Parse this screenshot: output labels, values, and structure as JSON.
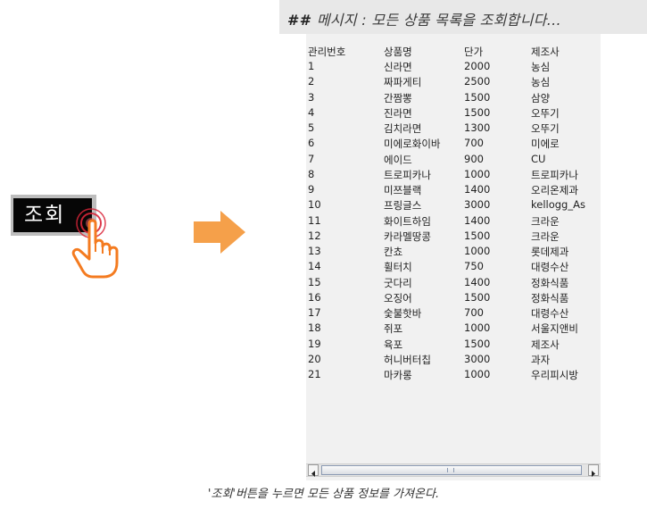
{
  "header": {
    "prefix": "##",
    "message": "메시지 : 모든 상품 목록을 조회합니다..."
  },
  "left_button": {
    "label": "조회"
  },
  "table": {
    "columns": [
      "관리번호",
      "상품명",
      "단가",
      "제조사"
    ],
    "rows": [
      [
        "1",
        "신라면",
        "2000",
        "농심"
      ],
      [
        "2",
        "짜파게티",
        "2500",
        "농심"
      ],
      [
        "3",
        "간짬뽕",
        "1500",
        "삼양"
      ],
      [
        "4",
        "진라면",
        "1500",
        "오뚜기"
      ],
      [
        "5",
        "김치라면",
        "1300",
        "오뚜기"
      ],
      [
        "6",
        "미에로화이바",
        "700",
        "미에로"
      ],
      [
        "7",
        "에이드",
        "900",
        "CU"
      ],
      [
        "8",
        "트로피카나",
        "1000",
        "트로피카나"
      ],
      [
        "9",
        "미쯔블랙",
        "1400",
        "오리온제과"
      ],
      [
        "10",
        "프링글스",
        "3000",
        "kellogg_As"
      ],
      [
        "11",
        "화이트하임",
        "1400",
        "크라운"
      ],
      [
        "12",
        "카라멜땅콩",
        "1500",
        "크라운"
      ],
      [
        "13",
        "칸쵸",
        "1000",
        "롯데제과"
      ],
      [
        "14",
        "휠터치",
        "750",
        "대령수산"
      ],
      [
        "15",
        "굿다리",
        "1400",
        "정화식품"
      ],
      [
        "16",
        "오징어",
        "1500",
        "정화식품"
      ],
      [
        "17",
        "숯불핫바",
        "700",
        "대령수산"
      ],
      [
        "18",
        "쥐포",
        "1000",
        "서울지앤비"
      ],
      [
        "19",
        "육포",
        "1500",
        "제조사"
      ],
      [
        "20",
        "허니버터칩",
        "3000",
        "과자"
      ],
      [
        "21",
        "마카롱",
        "1000",
        "우리피시방"
      ]
    ]
  },
  "caption": "'조회'버튼을 누르면 모든 상품 정보를 가져온다.",
  "colors": {
    "button_bg": "#060606",
    "arrow": "#f5a04a",
    "touch_ring": "#d9263a",
    "header_bg": "#e8e8e8",
    "panel_bg": "#f1f1f1"
  },
  "icons": {
    "hand": "pointing-hand-icon",
    "arrow": "right-arrow-icon"
  }
}
